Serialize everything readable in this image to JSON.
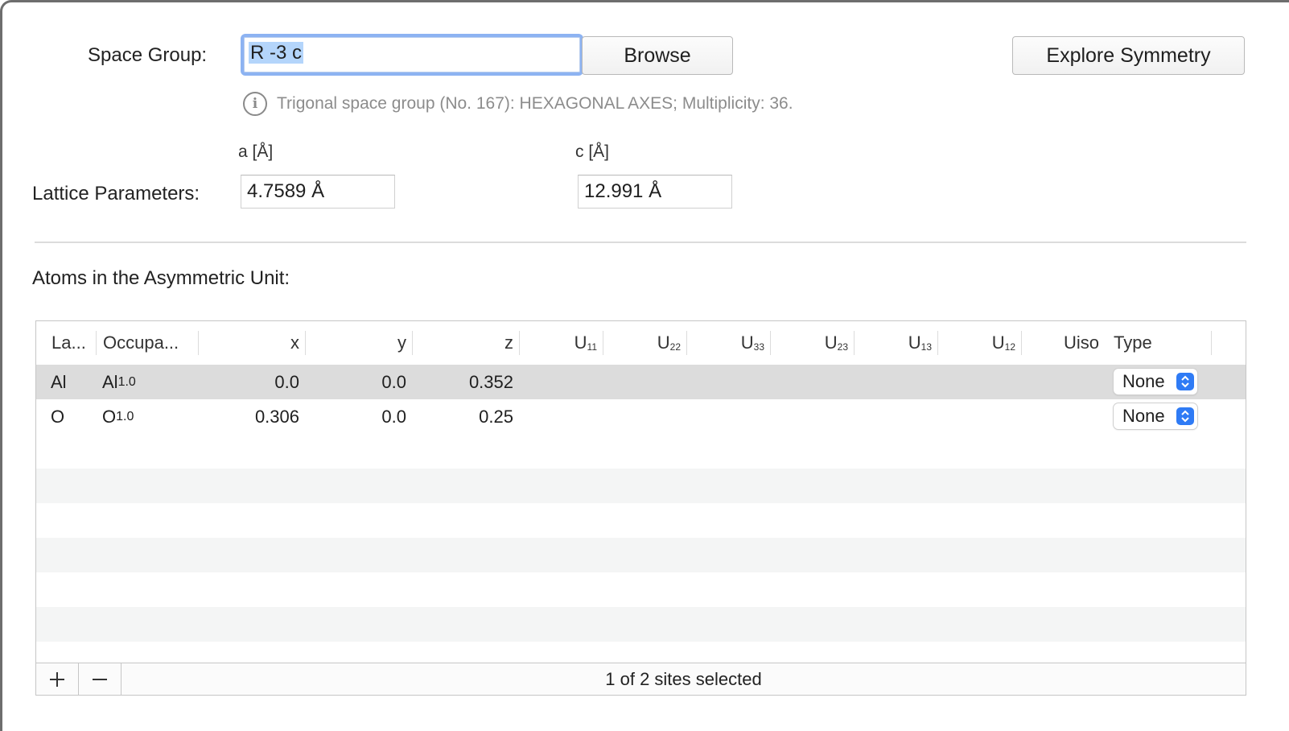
{
  "space_group": {
    "label": "Space Group:",
    "value": "R -3 c",
    "browse_label": "Browse",
    "explore_label": "Explore Symmetry",
    "info_icon": "info-circle-icon",
    "info_text": "Trigonal space group (No. 167): HEXAGONAL AXES; Multiplicity: 36."
  },
  "lattice": {
    "label": "Lattice Parameters:",
    "a_caption": "a [Å]",
    "a_value": "4.7589 Å",
    "c_caption": "c [Å]",
    "c_value": "12.991 Å"
  },
  "atoms": {
    "label": "Atoms in the Asymmetric Unit:",
    "columns": {
      "label": "La...",
      "occupancy": "Occupa...",
      "x": "x",
      "y": "y",
      "z": "z",
      "u11": "U",
      "u11_sub": "11",
      "u22": "U",
      "u22_sub": "22",
      "u33": "U",
      "u33_sub": "33",
      "u23": "U",
      "u23_sub": "23",
      "u13": "U",
      "u13_sub": "13",
      "u12": "U",
      "u12_sub": "12",
      "uiso": "Uiso",
      "type": "Type"
    },
    "rows": [
      {
        "label": "Al",
        "occ_el": "Al",
        "occ_sub": "1.0",
        "x": "0.0",
        "y": "0.0",
        "z": "0.352",
        "type": "None",
        "selected": true
      },
      {
        "label": "O",
        "occ_el": "O",
        "occ_sub": "1.0",
        "x": "0.306",
        "y": "0.0",
        "z": "0.25",
        "type": "None",
        "selected": false
      }
    ],
    "add_icon": "plus-icon",
    "remove_icon": "minus-icon",
    "status": "1 of 2 sites selected"
  },
  "colors": {
    "focus_ring": "#8db3f2",
    "selection": "#b4d5fb",
    "selected_row": "#dcdcdc",
    "accent": "#2f7bf5"
  }
}
